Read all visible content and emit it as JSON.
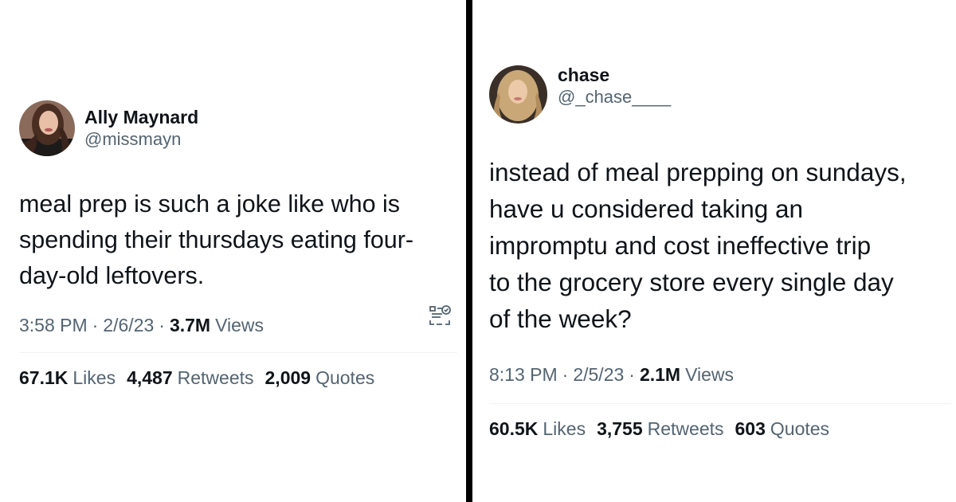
{
  "tweets": [
    {
      "display_name": "Ally Maynard",
      "handle": "@missmayn",
      "text": "meal prep is such a joke like who is\nspending their thursdays eating four-\nday-old leftovers.",
      "time": "3:58 PM",
      "date": "2/6/23",
      "views_count": "3.7M",
      "views_label": "Views",
      "likes_count": "67.1K",
      "likes_label": "Likes",
      "retweets_count": "4,487",
      "retweets_label": "Retweets",
      "quotes_count": "2,009",
      "quotes_label": "Quotes",
      "separator": "·"
    },
    {
      "display_name": "chase",
      "handle": "@_chase____",
      "text": "instead of meal prepping on sundays,\nhave u  considered taking an\nimpromptu and cost ineffective trip\nto the grocery store every single day\nof the week?",
      "time": "8:13 PM",
      "date": "2/5/23",
      "views_count": "2.1M",
      "views_label": "Views",
      "likes_count": "60.5K",
      "likes_label": "Likes",
      "retweets_count": "3,755",
      "retweets_label": "Retweets",
      "quotes_count": "603",
      "quotes_label": "Quotes",
      "separator": "·"
    }
  ],
  "colors": {
    "primary_text": "#0f1419",
    "secondary_text": "#536471",
    "divider": "#000000",
    "rule": "#eff3f4"
  },
  "icons": {
    "left_meta_icon": "qr-code-icon"
  }
}
